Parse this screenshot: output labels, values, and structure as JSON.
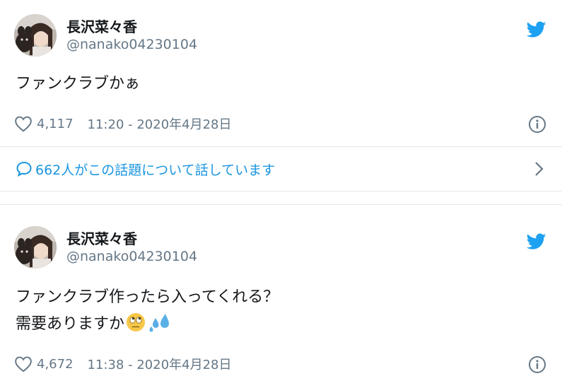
{
  "tweets": [
    {
      "name": "長沢菜々香",
      "handle": "@nanako04230104",
      "text_lines": [
        "ファンクラブかぁ"
      ],
      "likes": "4,117",
      "timestamp": "11:20 - 2020年4月28日"
    },
    {
      "name": "長沢菜々香",
      "handle": "@nanako04230104",
      "text_lines": [
        "ファンクラブ作ったら入ってくれる？",
        "需要ありますか"
      ],
      "emojis": [
        "face-with-rolling-eyes",
        "sweat-droplets"
      ],
      "likes": "4,672",
      "timestamp": "11:38 - 2020年4月28日"
    }
  ],
  "conversation": {
    "label": "662人がこの話題について話しています"
  },
  "colors": {
    "text": "#14171a",
    "secondary": "#657786",
    "twitter_blue": "#1da1f2",
    "link_blue": "#1b95e0",
    "divider": "#e1e8ed"
  },
  "icons": [
    "avatar",
    "twitter-bird-icon",
    "heart-icon",
    "info-icon",
    "speech-bubble-icon",
    "chevron-right-icon"
  ]
}
